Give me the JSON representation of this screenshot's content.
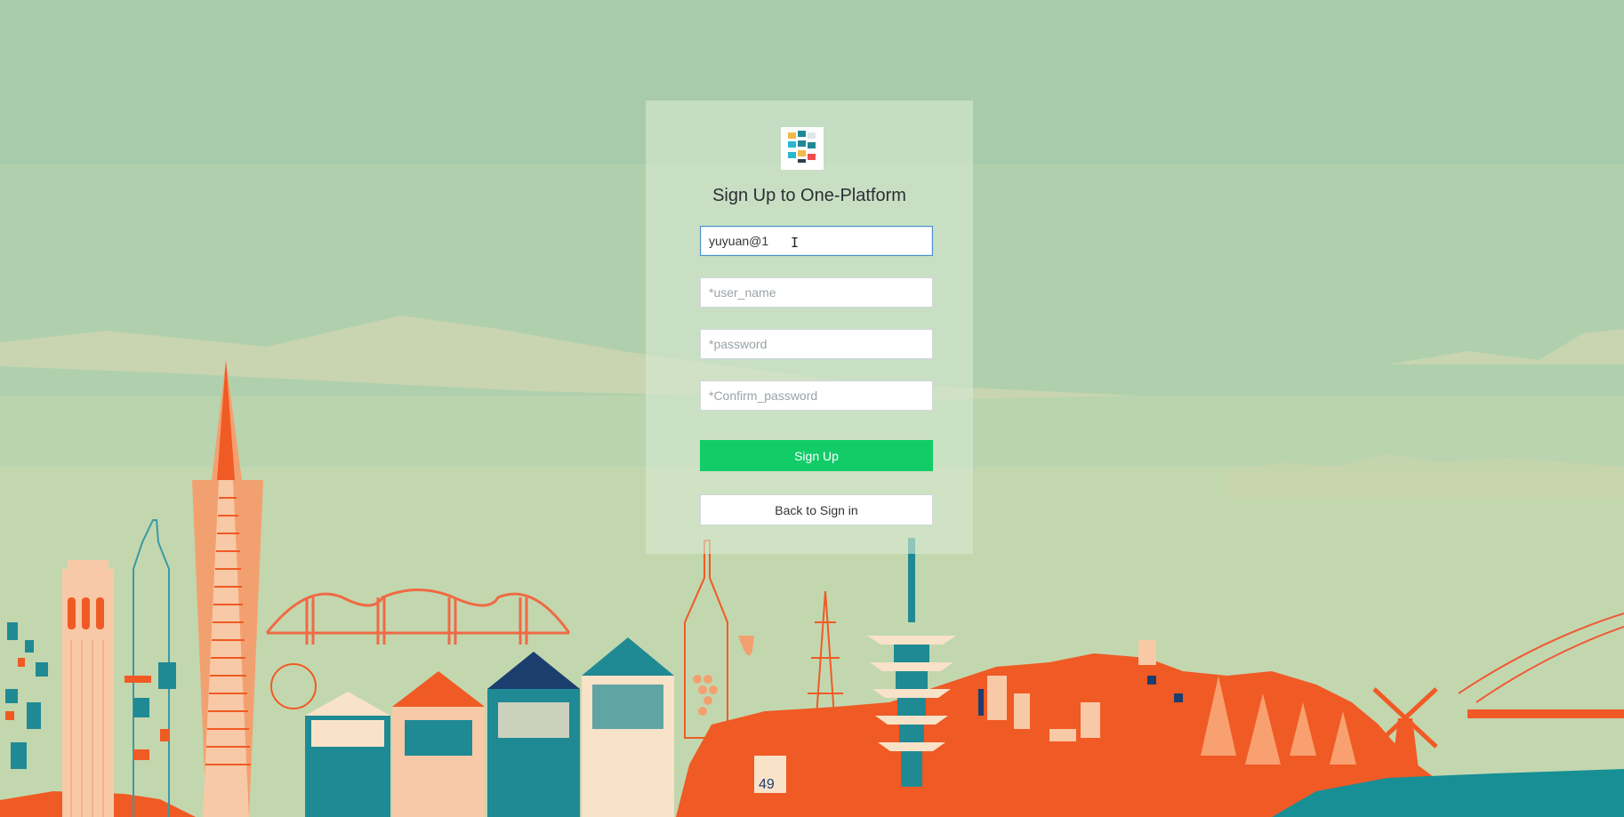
{
  "page": {
    "title": "Sign Up to One-Platform",
    "logo_icon": "one-platform-logo-icon"
  },
  "form": {
    "email_value": "yuyuan@1",
    "username_placeholder": "*user_name",
    "password_placeholder": "*password",
    "confirm_placeholder": "*Confirm_password",
    "signup_label": "Sign Up",
    "back_label": "Back to Sign in"
  },
  "background": {
    "scene": "city-skyline-illustration",
    "poster_number": "49"
  },
  "colors": {
    "primary_button": "#12cc68",
    "active_border": "#4a90c6",
    "skyline_orange": "#f05a24",
    "skyline_teal": "#1f8a94"
  }
}
